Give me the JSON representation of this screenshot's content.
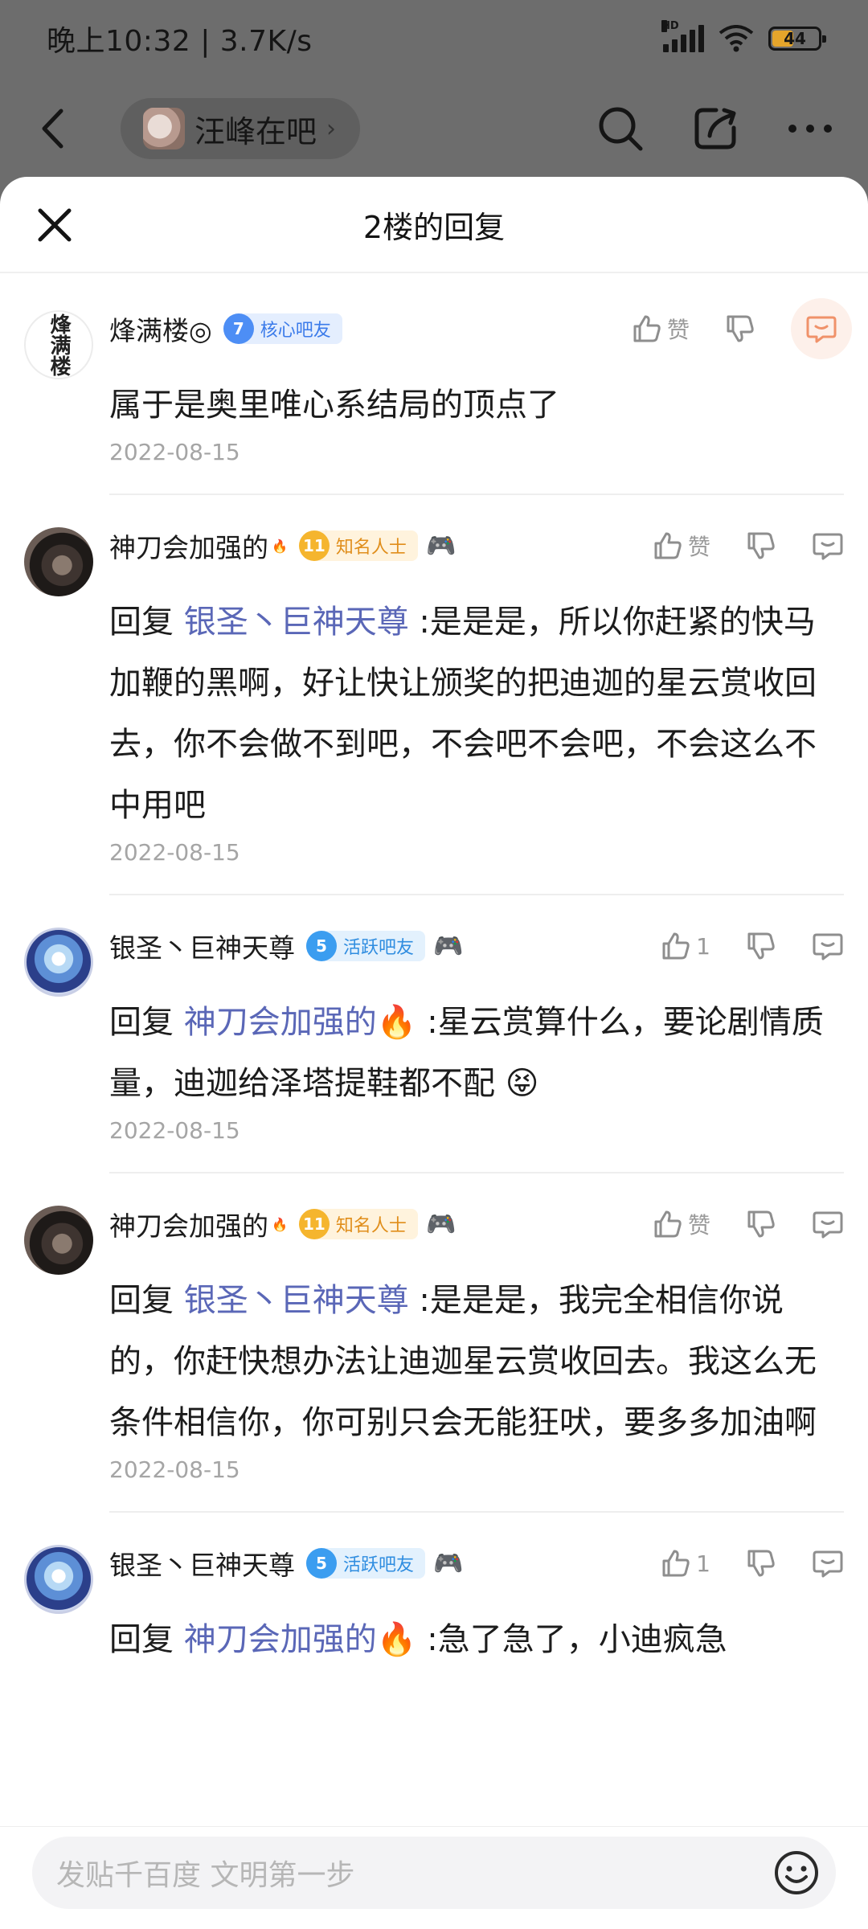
{
  "status_bar": {
    "time_speed": "晚上10:32 | 3.7K/s",
    "network": "HD",
    "battery": "44"
  },
  "nav": {
    "forum_name": "汪峰在吧",
    "chevron": "›"
  },
  "sheet": {
    "title": "2楼的回复"
  },
  "replies": [
    {
      "username": "烽满楼◎",
      "badge": {
        "level": "7",
        "label": "核心吧友"
      },
      "like": "赞",
      "avatar_text": "烽满楼",
      "text": "属于是奥里唯心系结局的顶点了",
      "date": "2022-08-15"
    },
    {
      "username": "神刀会加强的",
      "badge": {
        "level": "11",
        "label": "知名人士"
      },
      "like": "赞",
      "reply_prefix": "回复 ",
      "mention": "银圣丶巨神天尊",
      "text": " :是是是，所以你赶紧的快马加鞭的黑啊，好让快让颁奖的把迪迦的星云赏收回去，你不会做不到吧，不会吧不会吧，不会这么不中用吧",
      "date": "2022-08-15"
    },
    {
      "username": "银圣丶巨神天尊",
      "badge": {
        "level": "5",
        "label": "活跃吧友"
      },
      "like": "1",
      "reply_prefix": "回复 ",
      "mention": "神刀会加强的🔥",
      "text": " :星云赏算什么，要论剧情质量，迪迦给泽塔提鞋都不配 😝",
      "date": "2022-08-15"
    },
    {
      "username": "神刀会加强的",
      "badge": {
        "level": "11",
        "label": "知名人士"
      },
      "like": "赞",
      "reply_prefix": "回复 ",
      "mention": "银圣丶巨神天尊",
      "text": " :是是是，我完全相信你说的，你赶快想办法让迪迦星云赏收回去。我这么无条件相信你，你可别只会无能狂吠，要多多加油啊",
      "date": "2022-08-15"
    },
    {
      "username": "银圣丶巨神天尊",
      "badge": {
        "level": "5",
        "label": "活跃吧友"
      },
      "like": "1",
      "reply_prefix": "回复 ",
      "mention": "神刀会加强的🔥",
      "text": " :急了急了，小迪疯急"
    }
  ],
  "composer": {
    "placeholder": "发贴千百度 文明第一步"
  },
  "colors": {
    "mention": "#5a67b7",
    "badge_blue": "#3b7bea",
    "badge_gold": "#e08e1b"
  },
  "icons": [
    "back-icon",
    "search-icon",
    "share-icon",
    "more-icon",
    "close-icon",
    "thumb-up-icon",
    "thumb-down-icon",
    "comment-icon",
    "smile-icon",
    "fire-icon",
    "gamepad-icon"
  ]
}
